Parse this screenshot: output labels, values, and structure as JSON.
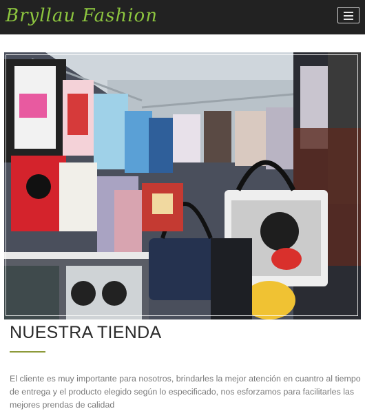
{
  "navbar": {
    "brand": "Bryllau Fashion",
    "menu_icon": "hamburger-menu-icon"
  },
  "hero": {
    "image_subject": "clothing-store-interior-photo"
  },
  "section": {
    "title": "NUESTRA TIENDA",
    "description": "El cliente es muy importante para nosotros, brindarles la mejor atención en cuantro al tiempo de entrega y el producto elegido según lo especificado, nos esforzamos para facilitarles las mejores prendas de calidad"
  },
  "colors": {
    "navbar_bg": "#222222",
    "brand": "#8dc63f",
    "divider": "#8d9a3a",
    "title": "#2b2b2b",
    "text": "#7a7a7a"
  }
}
